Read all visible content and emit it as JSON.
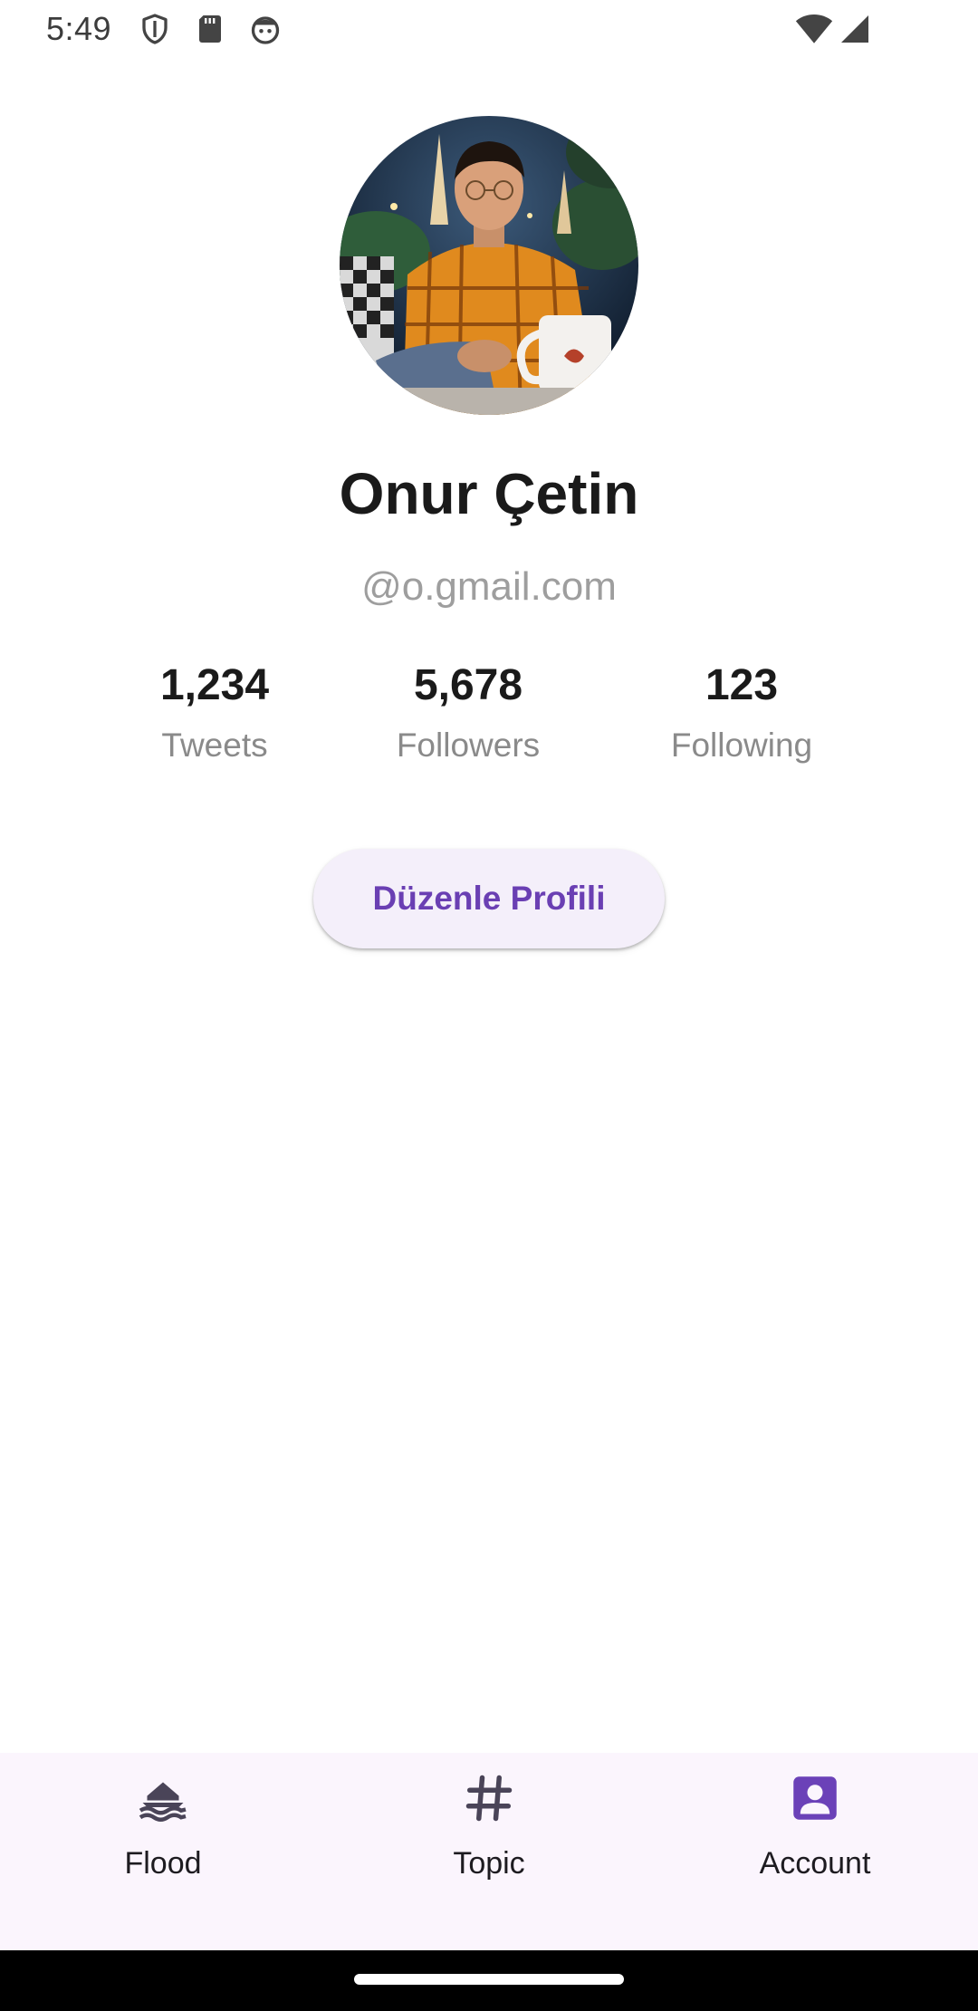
{
  "status_bar": {
    "time": "5:49",
    "left_icons": [
      "shield-icon",
      "sd-card-icon",
      "face-icon"
    ],
    "right_icons": [
      "wifi-icon",
      "signal-icon"
    ]
  },
  "profile": {
    "name": "Onur Çetin",
    "email": "@o.gmail.com",
    "avatar": "profile-photo"
  },
  "stats": [
    {
      "value": "1,234",
      "label": "Tweets"
    },
    {
      "value": "5,678",
      "label": "Followers"
    },
    {
      "value": "123",
      "label": "Following"
    }
  ],
  "edit_button": {
    "label": "Düzenle Profili"
  },
  "bottom_nav": {
    "items": [
      {
        "label": "Flood",
        "icon": "flood-icon",
        "active": false
      },
      {
        "label": "Topic",
        "icon": "hashtag-icon",
        "active": false
      },
      {
        "label": "Account",
        "icon": "account-box-icon",
        "active": true
      }
    ]
  },
  "colors": {
    "accent": "#6a3fb3",
    "active_icon": "#6b41b8",
    "button_bg": "#f4effa",
    "nav_bg": "#fbf5fd",
    "secondary_text": "#9e9e9e"
  }
}
